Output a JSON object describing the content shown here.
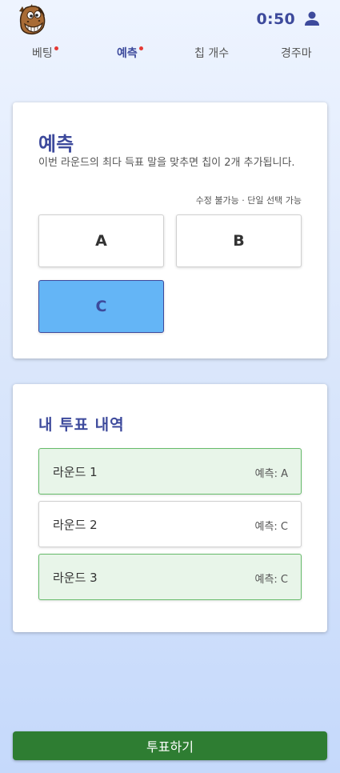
{
  "header": {
    "timer": "0:50",
    "logo_icon": "horse-mascot-icon",
    "user_icon": "user-icon"
  },
  "nav": {
    "items": [
      {
        "label": "베팅",
        "badge": true,
        "active": false
      },
      {
        "label": "예측",
        "badge": true,
        "active": true
      },
      {
        "label": "칩 개수",
        "badge": false,
        "active": false
      },
      {
        "label": "경주마",
        "badge": false,
        "active": false
      }
    ]
  },
  "predict": {
    "title": "예측",
    "description": "이번 라운드의 최다 득표 말을 맞추면 칩이 2개 추가됩니다.",
    "note": "수정 불가능 · 단일 선택 가능",
    "options": [
      {
        "label": "A",
        "selected": false
      },
      {
        "label": "B",
        "selected": false
      },
      {
        "label": "C",
        "selected": true
      }
    ]
  },
  "history": {
    "title": "내 투표 내역",
    "rows": [
      {
        "round": "라운드 1",
        "prediction": "예측: A",
        "status": "correct"
      },
      {
        "round": "라운드 2",
        "prediction": "예측: C",
        "status": "neutral"
      },
      {
        "round": "라운드 3",
        "prediction": "예측: C",
        "status": "correct"
      }
    ]
  },
  "vote_button": {
    "label": "투표하기"
  },
  "colors": {
    "accent": "#3d4a9c",
    "selected_option": "#64b5f6",
    "correct_bg": "#e8f5e9",
    "correct_border": "#66bb6a",
    "primary_button": "#2e7d32",
    "badge": "#e53935"
  }
}
